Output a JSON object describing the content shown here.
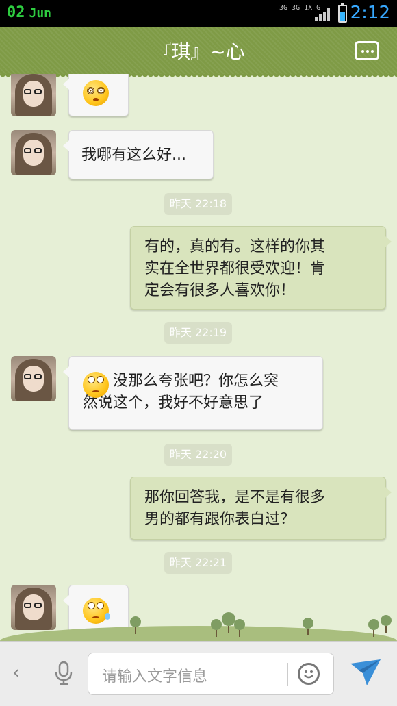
{
  "status_bar": {
    "date_day": "02",
    "date_month": "Jun",
    "network": "3G 3G 1X G",
    "time": "2:12",
    "battery_level": 0.6,
    "colors": {
      "clock": "#37a8ff",
      "date": "#2ecc40"
    }
  },
  "header": {
    "title": "『琪』~心",
    "menu_icon": "more-menu-icon",
    "background": "#7f9b46"
  },
  "messages": [
    {
      "side": "left",
      "kind": "emoji",
      "emoji": "dizzy-face-emoji"
    },
    {
      "side": "left",
      "kind": "text",
      "lines": [
        "我哪有这么好..."
      ]
    },
    {
      "side": "time",
      "text": "昨天 22:18"
    },
    {
      "side": "right",
      "kind": "text",
      "lines": [
        "有的，真的有。这样的你其",
        "实在全世界都很受欢迎！肯",
        "定会有很多人喜欢你！"
      ]
    },
    {
      "side": "time",
      "text": "昨天 22:19"
    },
    {
      "side": "left",
      "kind": "text",
      "emoji": "rolling-eyes-emoji",
      "lines": [
        "没那么夸张吧？你怎么突",
        "然说这个，我好不好意思了"
      ]
    },
    {
      "side": "time",
      "text": "昨天 22:20"
    },
    {
      "side": "right",
      "kind": "text",
      "lines": [
        "那你回答我，是不是有很多",
        "男的都有跟你表白过？"
      ]
    },
    {
      "side": "time",
      "text": "昨天 22:21"
    },
    {
      "side": "left",
      "kind": "emoji",
      "emoji": "sweat-rolling-eyes-emoji"
    }
  ],
  "input_bar": {
    "back_icon": "back-chevron-icon",
    "mic_icon": "microphone-icon",
    "placeholder": "请输入文字信息",
    "emoji_icon": "smiley-icon",
    "send_icon": "send-icon"
  }
}
